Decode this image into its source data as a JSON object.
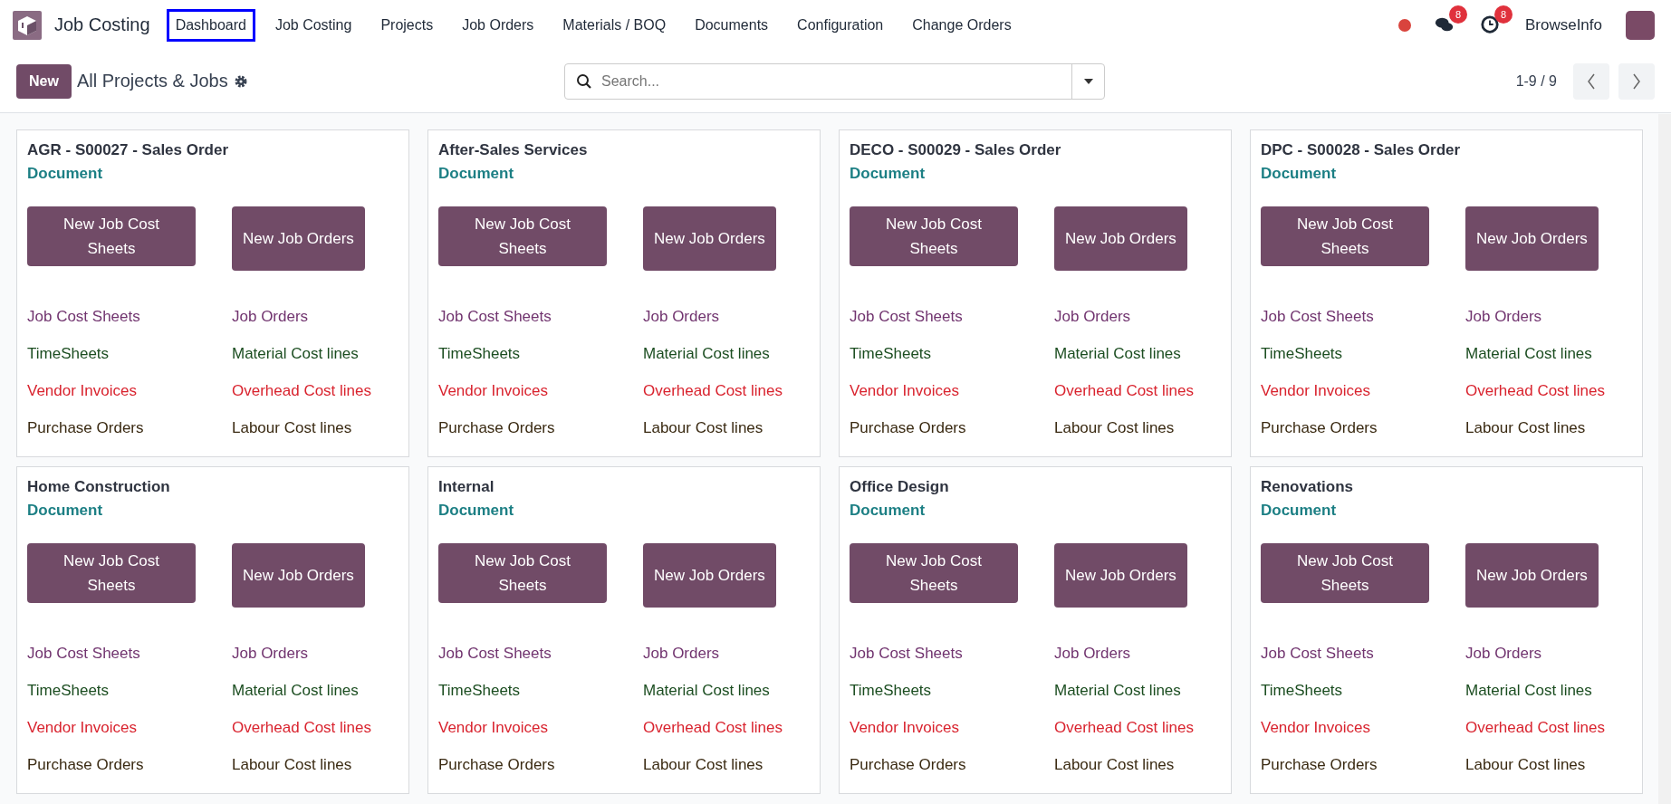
{
  "app": {
    "name": "Job Costing"
  },
  "menu": [
    {
      "label": "Dashboard",
      "highlighted": true
    },
    {
      "label": "Job Costing",
      "highlighted": false
    },
    {
      "label": "Projects",
      "highlighted": false
    },
    {
      "label": "Job Orders",
      "highlighted": false
    },
    {
      "label": "Materials / BOQ",
      "highlighted": false
    },
    {
      "label": "Documents",
      "highlighted": false
    },
    {
      "label": "Configuration",
      "highlighted": false
    },
    {
      "label": "Change Orders",
      "highlighted": false
    }
  ],
  "systray": {
    "messages_count": "8",
    "activities_count": "8",
    "company": "BrowseInfo"
  },
  "control_panel": {
    "new_button": "New",
    "breadcrumb": "All Projects & Jobs",
    "search": {
      "placeholder": "Search..."
    },
    "pager": "1-9 / 9"
  },
  "cards": [
    {
      "title": "AGR - S00027 - Sales Order",
      "subtitle": "Document",
      "buttons": [
        "New Job Cost Sheets",
        "New Job Orders"
      ],
      "links": [
        {
          "label": "Job Cost Sheets",
          "color": "#71346f"
        },
        {
          "label": "Job Orders",
          "color": "#71346f"
        },
        {
          "label": "TimeSheets",
          "color": "#1b4d20"
        },
        {
          "label": "Material Cost lines",
          "color": "#1b4d20"
        },
        {
          "label": "Vendor Invoices",
          "color": "#d9232e"
        },
        {
          "label": "Overhead Cost lines",
          "color": "#d9232e"
        },
        {
          "label": "Purchase Orders",
          "color": "#3a2a12"
        },
        {
          "label": "Labour Cost lines",
          "color": "#3a2a12"
        }
      ]
    },
    {
      "title": "After-Sales Services",
      "subtitle": "Document",
      "buttons": [
        "New Job Cost Sheets",
        "New Job Orders"
      ],
      "links": [
        {
          "label": "Job Cost Sheets",
          "color": "#71346f"
        },
        {
          "label": "Job Orders",
          "color": "#71346f"
        },
        {
          "label": "TimeSheets",
          "color": "#1b4d20"
        },
        {
          "label": "Material Cost lines",
          "color": "#1b4d20"
        },
        {
          "label": "Vendor Invoices",
          "color": "#d9232e"
        },
        {
          "label": "Overhead Cost lines",
          "color": "#d9232e"
        },
        {
          "label": "Purchase Orders",
          "color": "#3a2a12"
        },
        {
          "label": "Labour Cost lines",
          "color": "#3a2a12"
        }
      ]
    },
    {
      "title": "DECO - S00029 - Sales Order",
      "subtitle": "Document",
      "buttons": [
        "New Job Cost Sheets",
        "New Job Orders"
      ],
      "links": [
        {
          "label": "Job Cost Sheets",
          "color": "#71346f"
        },
        {
          "label": "Job Orders",
          "color": "#71346f"
        },
        {
          "label": "TimeSheets",
          "color": "#1b4d20"
        },
        {
          "label": "Material Cost lines",
          "color": "#1b4d20"
        },
        {
          "label": "Vendor Invoices",
          "color": "#d9232e"
        },
        {
          "label": "Overhead Cost lines",
          "color": "#d9232e"
        },
        {
          "label": "Purchase Orders",
          "color": "#3a2a12"
        },
        {
          "label": "Labour Cost lines",
          "color": "#3a2a12"
        }
      ]
    },
    {
      "title": "DPC - S00028 - Sales Order",
      "subtitle": "Document",
      "buttons": [
        "New Job Cost Sheets",
        "New Job Orders"
      ],
      "links": [
        {
          "label": "Job Cost Sheets",
          "color": "#71346f"
        },
        {
          "label": "Job Orders",
          "color": "#71346f"
        },
        {
          "label": "TimeSheets",
          "color": "#1b4d20"
        },
        {
          "label": "Material Cost lines",
          "color": "#1b4d20"
        },
        {
          "label": "Vendor Invoices",
          "color": "#d9232e"
        },
        {
          "label": "Overhead Cost lines",
          "color": "#d9232e"
        },
        {
          "label": "Purchase Orders",
          "color": "#3a2a12"
        },
        {
          "label": "Labour Cost lines",
          "color": "#3a2a12"
        }
      ]
    },
    {
      "title": "Home Construction",
      "subtitle": "Document",
      "buttons": [
        "New Job Cost Sheets",
        "New Job Orders"
      ],
      "links": [
        {
          "label": "Job Cost Sheets",
          "color": "#71346f"
        },
        {
          "label": "Job Orders",
          "color": "#71346f"
        },
        {
          "label": "TimeSheets",
          "color": "#1b4d20"
        },
        {
          "label": "Material Cost lines",
          "color": "#1b4d20"
        },
        {
          "label": "Vendor Invoices",
          "color": "#d9232e"
        },
        {
          "label": "Overhead Cost lines",
          "color": "#d9232e"
        },
        {
          "label": "Purchase Orders",
          "color": "#3a2a12"
        },
        {
          "label": "Labour Cost lines",
          "color": "#3a2a12"
        }
      ]
    },
    {
      "title": "Internal",
      "subtitle": "Document",
      "buttons": [
        "New Job Cost Sheets",
        "New Job Orders"
      ],
      "links": [
        {
          "label": "Job Cost Sheets",
          "color": "#71346f"
        },
        {
          "label": "Job Orders",
          "color": "#71346f"
        },
        {
          "label": "TimeSheets",
          "color": "#1b4d20"
        },
        {
          "label": "Material Cost lines",
          "color": "#1b4d20"
        },
        {
          "label": "Vendor Invoices",
          "color": "#d9232e"
        },
        {
          "label": "Overhead Cost lines",
          "color": "#d9232e"
        },
        {
          "label": "Purchase Orders",
          "color": "#3a2a12"
        },
        {
          "label": "Labour Cost lines",
          "color": "#3a2a12"
        }
      ]
    },
    {
      "title": "Office Design",
      "subtitle": "Document",
      "buttons": [
        "New Job Cost Sheets",
        "New Job Orders"
      ],
      "links": [
        {
          "label": "Job Cost Sheets",
          "color": "#71346f"
        },
        {
          "label": "Job Orders",
          "color": "#71346f"
        },
        {
          "label": "TimeSheets",
          "color": "#1b4d20"
        },
        {
          "label": "Material Cost lines",
          "color": "#1b4d20"
        },
        {
          "label": "Vendor Invoices",
          "color": "#d9232e"
        },
        {
          "label": "Overhead Cost lines",
          "color": "#d9232e"
        },
        {
          "label": "Purchase Orders",
          "color": "#3a2a12"
        },
        {
          "label": "Labour Cost lines",
          "color": "#3a2a12"
        }
      ]
    },
    {
      "title": "Renovations",
      "subtitle": "Document",
      "buttons": [
        "New Job Cost Sheets",
        "New Job Orders"
      ],
      "links": [
        {
          "label": "Job Cost Sheets",
          "color": "#71346f"
        },
        {
          "label": "Job Orders",
          "color": "#71346f"
        },
        {
          "label": "TimeSheets",
          "color": "#1b4d20"
        },
        {
          "label": "Material Cost lines",
          "color": "#1b4d20"
        },
        {
          "label": "Vendor Invoices",
          "color": "#d9232e"
        },
        {
          "label": "Overhead Cost lines",
          "color": "#d9232e"
        },
        {
          "label": "Purchase Orders",
          "color": "#3a2a12"
        },
        {
          "label": "Labour Cost lines",
          "color": "#3a2a12"
        }
      ]
    }
  ]
}
